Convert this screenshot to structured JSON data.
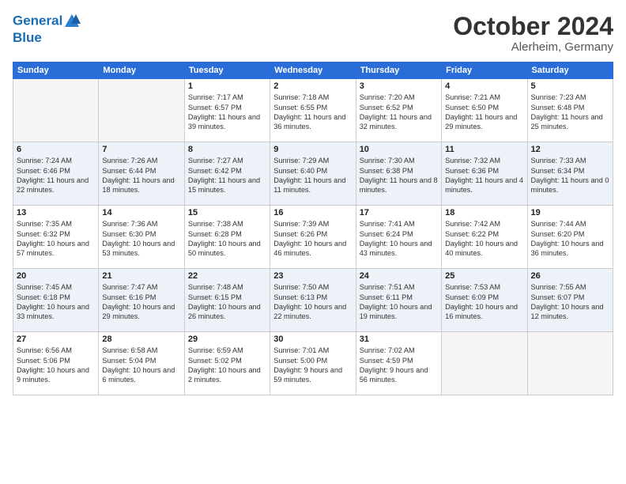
{
  "header": {
    "logo_line1": "General",
    "logo_line2": "Blue",
    "month": "October 2024",
    "location": "Alerheim, Germany"
  },
  "weekdays": [
    "Sunday",
    "Monday",
    "Tuesday",
    "Wednesday",
    "Thursday",
    "Friday",
    "Saturday"
  ],
  "weeks": [
    [
      {
        "num": "",
        "info": ""
      },
      {
        "num": "",
        "info": ""
      },
      {
        "num": "1",
        "info": "Sunrise: 7:17 AM\nSunset: 6:57 PM\nDaylight: 11 hours and 39 minutes."
      },
      {
        "num": "2",
        "info": "Sunrise: 7:18 AM\nSunset: 6:55 PM\nDaylight: 11 hours and 36 minutes."
      },
      {
        "num": "3",
        "info": "Sunrise: 7:20 AM\nSunset: 6:52 PM\nDaylight: 11 hours and 32 minutes."
      },
      {
        "num": "4",
        "info": "Sunrise: 7:21 AM\nSunset: 6:50 PM\nDaylight: 11 hours and 29 minutes."
      },
      {
        "num": "5",
        "info": "Sunrise: 7:23 AM\nSunset: 6:48 PM\nDaylight: 11 hours and 25 minutes."
      }
    ],
    [
      {
        "num": "6",
        "info": "Sunrise: 7:24 AM\nSunset: 6:46 PM\nDaylight: 11 hours and 22 minutes."
      },
      {
        "num": "7",
        "info": "Sunrise: 7:26 AM\nSunset: 6:44 PM\nDaylight: 11 hours and 18 minutes."
      },
      {
        "num": "8",
        "info": "Sunrise: 7:27 AM\nSunset: 6:42 PM\nDaylight: 11 hours and 15 minutes."
      },
      {
        "num": "9",
        "info": "Sunrise: 7:29 AM\nSunset: 6:40 PM\nDaylight: 11 hours and 11 minutes."
      },
      {
        "num": "10",
        "info": "Sunrise: 7:30 AM\nSunset: 6:38 PM\nDaylight: 11 hours and 8 minutes."
      },
      {
        "num": "11",
        "info": "Sunrise: 7:32 AM\nSunset: 6:36 PM\nDaylight: 11 hours and 4 minutes."
      },
      {
        "num": "12",
        "info": "Sunrise: 7:33 AM\nSunset: 6:34 PM\nDaylight: 11 hours and 0 minutes."
      }
    ],
    [
      {
        "num": "13",
        "info": "Sunrise: 7:35 AM\nSunset: 6:32 PM\nDaylight: 10 hours and 57 minutes."
      },
      {
        "num": "14",
        "info": "Sunrise: 7:36 AM\nSunset: 6:30 PM\nDaylight: 10 hours and 53 minutes."
      },
      {
        "num": "15",
        "info": "Sunrise: 7:38 AM\nSunset: 6:28 PM\nDaylight: 10 hours and 50 minutes."
      },
      {
        "num": "16",
        "info": "Sunrise: 7:39 AM\nSunset: 6:26 PM\nDaylight: 10 hours and 46 minutes."
      },
      {
        "num": "17",
        "info": "Sunrise: 7:41 AM\nSunset: 6:24 PM\nDaylight: 10 hours and 43 minutes."
      },
      {
        "num": "18",
        "info": "Sunrise: 7:42 AM\nSunset: 6:22 PM\nDaylight: 10 hours and 40 minutes."
      },
      {
        "num": "19",
        "info": "Sunrise: 7:44 AM\nSunset: 6:20 PM\nDaylight: 10 hours and 36 minutes."
      }
    ],
    [
      {
        "num": "20",
        "info": "Sunrise: 7:45 AM\nSunset: 6:18 PM\nDaylight: 10 hours and 33 minutes."
      },
      {
        "num": "21",
        "info": "Sunrise: 7:47 AM\nSunset: 6:16 PM\nDaylight: 10 hours and 29 minutes."
      },
      {
        "num": "22",
        "info": "Sunrise: 7:48 AM\nSunset: 6:15 PM\nDaylight: 10 hours and 26 minutes."
      },
      {
        "num": "23",
        "info": "Sunrise: 7:50 AM\nSunset: 6:13 PM\nDaylight: 10 hours and 22 minutes."
      },
      {
        "num": "24",
        "info": "Sunrise: 7:51 AM\nSunset: 6:11 PM\nDaylight: 10 hours and 19 minutes."
      },
      {
        "num": "25",
        "info": "Sunrise: 7:53 AM\nSunset: 6:09 PM\nDaylight: 10 hours and 16 minutes."
      },
      {
        "num": "26",
        "info": "Sunrise: 7:55 AM\nSunset: 6:07 PM\nDaylight: 10 hours and 12 minutes."
      }
    ],
    [
      {
        "num": "27",
        "info": "Sunrise: 6:56 AM\nSunset: 5:06 PM\nDaylight: 10 hours and 9 minutes."
      },
      {
        "num": "28",
        "info": "Sunrise: 6:58 AM\nSunset: 5:04 PM\nDaylight: 10 hours and 6 minutes."
      },
      {
        "num": "29",
        "info": "Sunrise: 6:59 AM\nSunset: 5:02 PM\nDaylight: 10 hours and 2 minutes."
      },
      {
        "num": "30",
        "info": "Sunrise: 7:01 AM\nSunset: 5:00 PM\nDaylight: 9 hours and 59 minutes."
      },
      {
        "num": "31",
        "info": "Sunrise: 7:02 AM\nSunset: 4:59 PM\nDaylight: 9 hours and 56 minutes."
      },
      {
        "num": "",
        "info": ""
      },
      {
        "num": "",
        "info": ""
      }
    ]
  ]
}
